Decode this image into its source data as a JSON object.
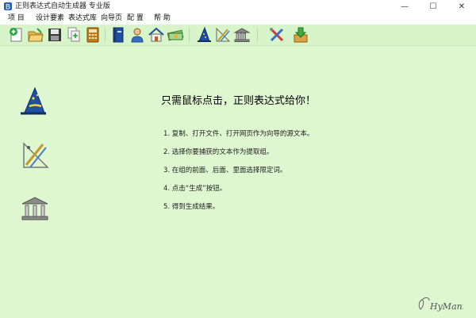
{
  "window": {
    "title": "正则表达式自动生成器 专业版",
    "controls": {
      "minimize": "—",
      "maximize": "☐",
      "close": "✕"
    }
  },
  "menu": [
    {
      "label": "项  目"
    },
    {
      "label": "设计要素"
    },
    {
      "label": "表达式库"
    },
    {
      "label": "向导页"
    },
    {
      "label": "配  置"
    },
    {
      "label": "帮  助"
    }
  ],
  "toolbar": {
    "icons": [
      "new-project-icon",
      "open-folder-icon",
      "save-disk-icon",
      "copy-document-icon",
      "calculator-icon",
      "book-icon",
      "user-icon",
      "home-icon",
      "money-icon",
      "wizard-hat-icon",
      "drawing-tools-icon",
      "library-building-icon",
      "tools-icon",
      "download-box-icon"
    ]
  },
  "main": {
    "headline": "只需鼠标点击，正则表达式给你！",
    "steps": [
      "1. 复制、打开文件、打开网页作为向导的源文本。",
      "2. 选择你要捕获的文本作为提取组。",
      "3. 在组的前面、后面、里面选择限定词。",
      "4. 点击“生成”按钮。",
      "5. 得到生成结果。"
    ],
    "side_icons": [
      "wizard-hat-icon",
      "drawing-tools-icon",
      "library-building-icon"
    ]
  },
  "signature": "HyMann",
  "colors": {
    "content_bg": "#dff7d0",
    "toolbar_bg": "#d7f5c8",
    "titlebar_bg": "#ffffff"
  }
}
